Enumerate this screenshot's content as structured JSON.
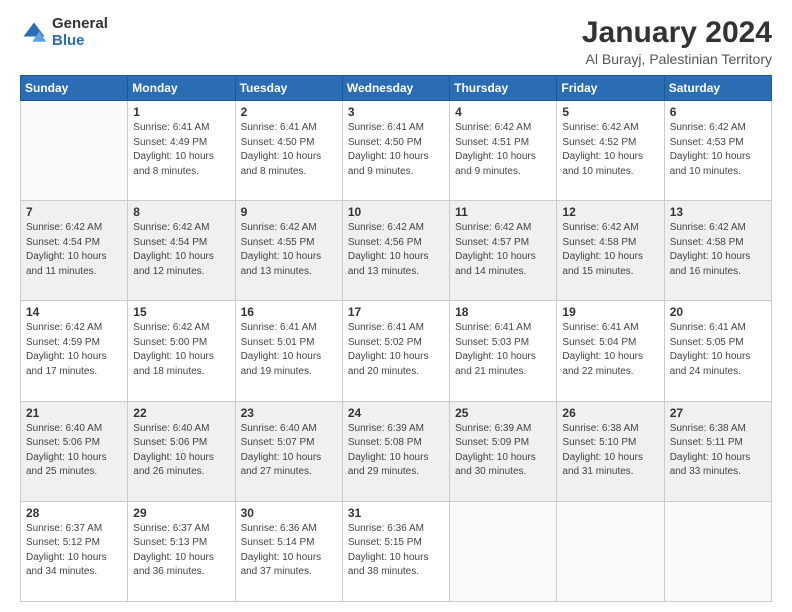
{
  "logo": {
    "general": "General",
    "blue": "Blue"
  },
  "header": {
    "title": "January 2024",
    "subtitle": "Al Burayj, Palestinian Territory"
  },
  "weekdays": [
    "Sunday",
    "Monday",
    "Tuesday",
    "Wednesday",
    "Thursday",
    "Friday",
    "Saturday"
  ],
  "weeks": [
    [
      {
        "day": "",
        "info": ""
      },
      {
        "day": "1",
        "info": "Sunrise: 6:41 AM\nSunset: 4:49 PM\nDaylight: 10 hours\nand 8 minutes."
      },
      {
        "day": "2",
        "info": "Sunrise: 6:41 AM\nSunset: 4:50 PM\nDaylight: 10 hours\nand 8 minutes."
      },
      {
        "day": "3",
        "info": "Sunrise: 6:41 AM\nSunset: 4:50 PM\nDaylight: 10 hours\nand 9 minutes."
      },
      {
        "day": "4",
        "info": "Sunrise: 6:42 AM\nSunset: 4:51 PM\nDaylight: 10 hours\nand 9 minutes."
      },
      {
        "day": "5",
        "info": "Sunrise: 6:42 AM\nSunset: 4:52 PM\nDaylight: 10 hours\nand 10 minutes."
      },
      {
        "day": "6",
        "info": "Sunrise: 6:42 AM\nSunset: 4:53 PM\nDaylight: 10 hours\nand 10 minutes."
      }
    ],
    [
      {
        "day": "7",
        "info": "Sunrise: 6:42 AM\nSunset: 4:54 PM\nDaylight: 10 hours\nand 11 minutes."
      },
      {
        "day": "8",
        "info": "Sunrise: 6:42 AM\nSunset: 4:54 PM\nDaylight: 10 hours\nand 12 minutes."
      },
      {
        "day": "9",
        "info": "Sunrise: 6:42 AM\nSunset: 4:55 PM\nDaylight: 10 hours\nand 13 minutes."
      },
      {
        "day": "10",
        "info": "Sunrise: 6:42 AM\nSunset: 4:56 PM\nDaylight: 10 hours\nand 13 minutes."
      },
      {
        "day": "11",
        "info": "Sunrise: 6:42 AM\nSunset: 4:57 PM\nDaylight: 10 hours\nand 14 minutes."
      },
      {
        "day": "12",
        "info": "Sunrise: 6:42 AM\nSunset: 4:58 PM\nDaylight: 10 hours\nand 15 minutes."
      },
      {
        "day": "13",
        "info": "Sunrise: 6:42 AM\nSunset: 4:58 PM\nDaylight: 10 hours\nand 16 minutes."
      }
    ],
    [
      {
        "day": "14",
        "info": "Sunrise: 6:42 AM\nSunset: 4:59 PM\nDaylight: 10 hours\nand 17 minutes."
      },
      {
        "day": "15",
        "info": "Sunrise: 6:42 AM\nSunset: 5:00 PM\nDaylight: 10 hours\nand 18 minutes."
      },
      {
        "day": "16",
        "info": "Sunrise: 6:41 AM\nSunset: 5:01 PM\nDaylight: 10 hours\nand 19 minutes."
      },
      {
        "day": "17",
        "info": "Sunrise: 6:41 AM\nSunset: 5:02 PM\nDaylight: 10 hours\nand 20 minutes."
      },
      {
        "day": "18",
        "info": "Sunrise: 6:41 AM\nSunset: 5:03 PM\nDaylight: 10 hours\nand 21 minutes."
      },
      {
        "day": "19",
        "info": "Sunrise: 6:41 AM\nSunset: 5:04 PM\nDaylight: 10 hours\nand 22 minutes."
      },
      {
        "day": "20",
        "info": "Sunrise: 6:41 AM\nSunset: 5:05 PM\nDaylight: 10 hours\nand 24 minutes."
      }
    ],
    [
      {
        "day": "21",
        "info": "Sunrise: 6:40 AM\nSunset: 5:06 PM\nDaylight: 10 hours\nand 25 minutes."
      },
      {
        "day": "22",
        "info": "Sunrise: 6:40 AM\nSunset: 5:06 PM\nDaylight: 10 hours\nand 26 minutes."
      },
      {
        "day": "23",
        "info": "Sunrise: 6:40 AM\nSunset: 5:07 PM\nDaylight: 10 hours\nand 27 minutes."
      },
      {
        "day": "24",
        "info": "Sunrise: 6:39 AM\nSunset: 5:08 PM\nDaylight: 10 hours\nand 29 minutes."
      },
      {
        "day": "25",
        "info": "Sunrise: 6:39 AM\nSunset: 5:09 PM\nDaylight: 10 hours\nand 30 minutes."
      },
      {
        "day": "26",
        "info": "Sunrise: 6:38 AM\nSunset: 5:10 PM\nDaylight: 10 hours\nand 31 minutes."
      },
      {
        "day": "27",
        "info": "Sunrise: 6:38 AM\nSunset: 5:11 PM\nDaylight: 10 hours\nand 33 minutes."
      }
    ],
    [
      {
        "day": "28",
        "info": "Sunrise: 6:37 AM\nSunset: 5:12 PM\nDaylight: 10 hours\nand 34 minutes."
      },
      {
        "day": "29",
        "info": "Sunrise: 6:37 AM\nSunset: 5:13 PM\nDaylight: 10 hours\nand 36 minutes."
      },
      {
        "day": "30",
        "info": "Sunrise: 6:36 AM\nSunset: 5:14 PM\nDaylight: 10 hours\nand 37 minutes."
      },
      {
        "day": "31",
        "info": "Sunrise: 6:36 AM\nSunset: 5:15 PM\nDaylight: 10 hours\nand 38 minutes."
      },
      {
        "day": "",
        "info": ""
      },
      {
        "day": "",
        "info": ""
      },
      {
        "day": "",
        "info": ""
      }
    ]
  ]
}
